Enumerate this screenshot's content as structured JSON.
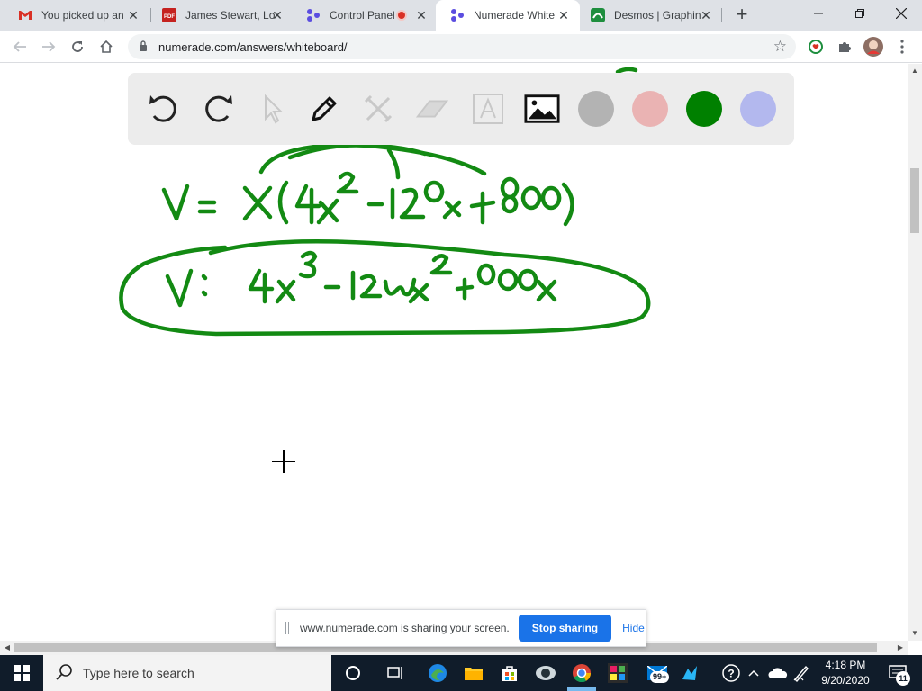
{
  "browser": {
    "tabs": [
      {
        "title": "You picked up an",
        "icon": "gmail-icon",
        "active": false
      },
      {
        "title": "James Stewart, Lo",
        "icon": "pdf-icon",
        "active": false
      },
      {
        "title": "Control Panel",
        "icon": "numerade-icon",
        "active": false,
        "recording": true
      },
      {
        "title": "Numerade White",
        "icon": "numerade-icon",
        "active": true
      },
      {
        "title": "Desmos | Graphin",
        "icon": "desmos-icon",
        "active": false
      }
    ],
    "url": "numerade.com/answers/whiteboard/"
  },
  "whiteboard": {
    "tools": [
      "undo-icon",
      "redo-icon",
      "pointer-icon",
      "pen-icon",
      "tools-icon",
      "eraser-icon",
      "text-icon",
      "image-icon"
    ],
    "swatches": [
      "#b3b3b3",
      "#eab3b3",
      "#008000",
      "#b3b8ee"
    ],
    "ink_color": "#138a13"
  },
  "sharing": {
    "message": "www.numerade.com is sharing your screen.",
    "stop_label": "Stop sharing",
    "hide_label": "Hide"
  },
  "taskbar": {
    "search_placeholder": "Type here to search",
    "time": "4:18 PM",
    "date": "9/20/2020",
    "mail_badge": "99+",
    "notif_count": "11"
  }
}
